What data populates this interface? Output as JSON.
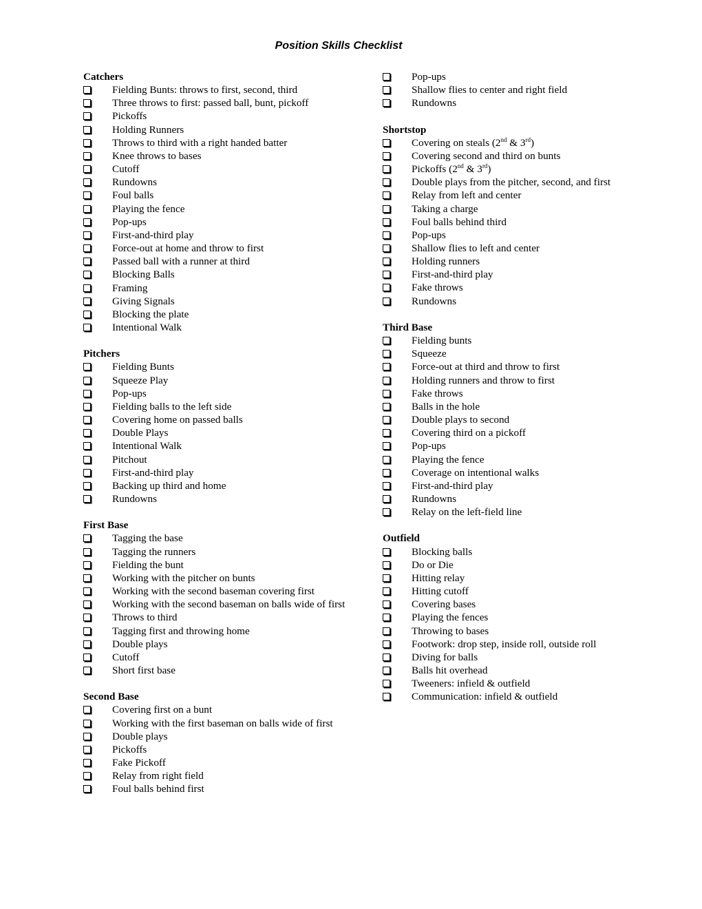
{
  "title": "Position Skills Checklist",
  "left_column": [
    {
      "heading": "Catchers",
      "items": [
        "Fielding Bunts: throws to first, second, third",
        "Three throws to first: passed ball, bunt, pickoff",
        "Pickoffs",
        "Holding Runners",
        "Throws to third with a right handed batter",
        "Knee throws to bases",
        "Cutoff",
        "Rundowns",
        "Foul balls",
        "Playing the fence",
        "Pop-ups",
        "First-and-third play",
        "Force-out at home and throw to first",
        "Passed ball with a runner at third",
        "Blocking Balls",
        "Framing",
        "Giving Signals",
        "Blocking the plate",
        "Intentional Walk"
      ]
    },
    {
      "heading": "Pitchers",
      "items": [
        "Fielding Bunts",
        "Squeeze Play",
        "Pop-ups",
        "Fielding balls to the left side",
        "Covering home on passed balls",
        "Double Plays",
        "Intentional Walk",
        "Pitchout",
        "First-and-third play",
        "Backing up third and home",
        "Rundowns"
      ]
    },
    {
      "heading": "First Base",
      "items": [
        "Tagging the base",
        "Tagging the runners",
        "Fielding the bunt",
        "Working with the pitcher on bunts",
        "Working with the second baseman covering first",
        "Working with the second baseman on balls wide of first",
        "Throws to third",
        "Tagging first and throwing home",
        "Double plays",
        "Cutoff",
        "Short first base"
      ]
    },
    {
      "heading": "Second Base",
      "items": [
        "Covering first on a bunt",
        "Working with the first baseman on balls wide of first",
        "Double plays",
        "Pickoffs",
        "Fake Pickoff",
        "Relay from right field",
        "Foul balls behind first"
      ]
    }
  ],
  "right_column": [
    {
      "heading": "",
      "items": [
        "Pop-ups",
        "Shallow flies to center and right field",
        "Rundowns"
      ]
    },
    {
      "heading": "Shortstop",
      "items": [
        "Covering on steals (2^nd & 3^rd)",
        "Covering second and third on bunts",
        "Pickoffs (2^nd & 3^rd)",
        "Double plays from the pitcher, second, and first",
        "Relay from left and center",
        "Taking a charge",
        "Foul balls behind third",
        "Pop-ups",
        "Shallow flies to left and center",
        "Holding runners",
        "First-and-third play",
        "Fake throws",
        "Rundowns"
      ]
    },
    {
      "heading": "Third Base",
      "items": [
        "Fielding bunts",
        "Squeeze",
        "Force-out at third and throw to first",
        "Holding runners and throw to first",
        "Fake throws",
        "Balls in the hole",
        "Double plays to second",
        "Covering third on a pickoff",
        "Pop-ups",
        "Playing the fence",
        "Coverage on intentional walks",
        "First-and-third play",
        "Rundowns",
        "Relay on the left-field line"
      ]
    },
    {
      "heading": "Outfield",
      "items": [
        "Blocking balls",
        "Do or Die",
        "Hitting relay",
        "Hitting cutoff",
        "Covering bases",
        "Playing the fences",
        "Throwing to bases",
        "Footwork: drop step, inside roll, outside roll",
        "Diving for balls",
        "Balls hit overhead",
        "Tweeners: infield & outfield",
        "Communication: infield & outfield"
      ]
    }
  ]
}
